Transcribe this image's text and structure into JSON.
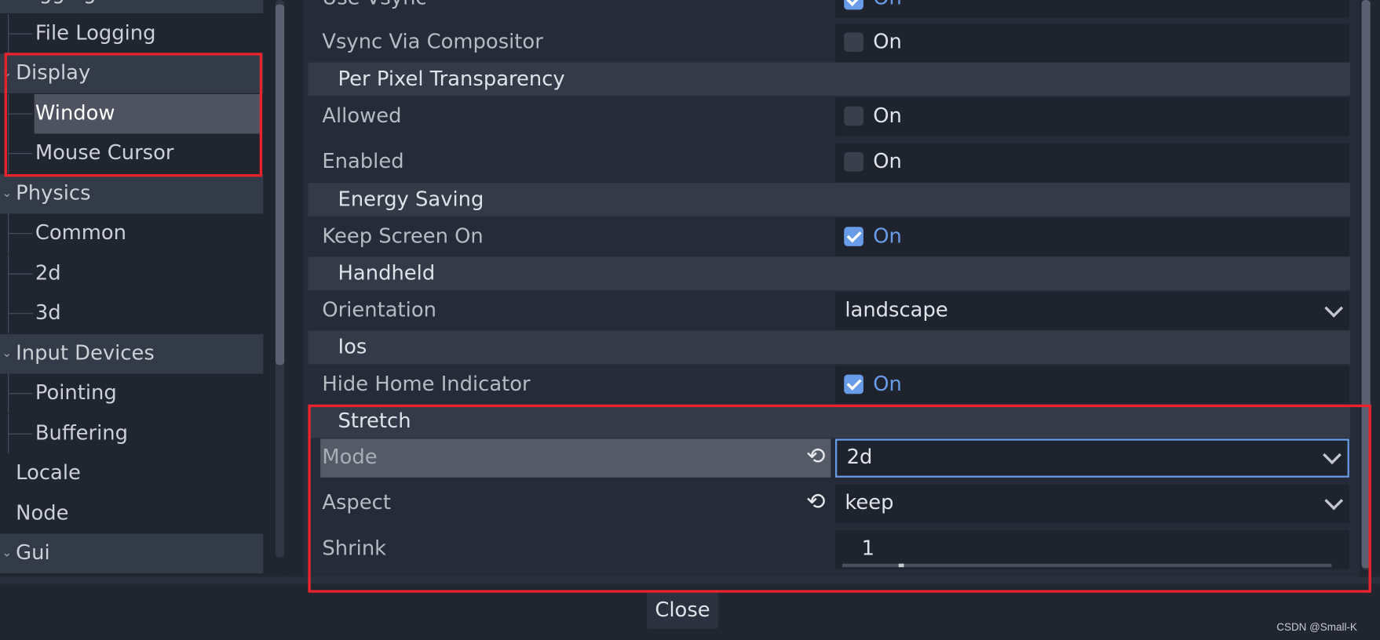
{
  "tree": {
    "items": [
      {
        "label": "Logging",
        "type": "category"
      },
      {
        "label": "File Logging",
        "type": "child"
      },
      {
        "label": "Display",
        "type": "category"
      },
      {
        "label": "Window",
        "type": "child",
        "selected": true
      },
      {
        "label": "Mouse Cursor",
        "type": "child"
      },
      {
        "label": "Physics",
        "type": "category"
      },
      {
        "label": "Common",
        "type": "child"
      },
      {
        "label": "2d",
        "type": "child"
      },
      {
        "label": "3d",
        "type": "child"
      },
      {
        "label": "Input Devices",
        "type": "category"
      },
      {
        "label": "Pointing",
        "type": "child"
      },
      {
        "label": "Buffering",
        "type": "child"
      },
      {
        "label": "Locale",
        "type": "plain"
      },
      {
        "label": "Node",
        "type": "plain"
      },
      {
        "label": "Gui",
        "type": "category"
      }
    ]
  },
  "inspector": {
    "use_vsync": {
      "label": "Use Vsync",
      "value": "On",
      "checked": true
    },
    "vsync_via_compositor": {
      "label": "Vsync Via Compositor",
      "value": "On",
      "checked": false
    },
    "section_ppt": "Per Pixel Transparency",
    "allowed": {
      "label": "Allowed",
      "value": "On",
      "checked": false
    },
    "enabled": {
      "label": "Enabled",
      "value": "On",
      "checked": false
    },
    "section_energy": "Energy Saving",
    "keep_screen_on": {
      "label": "Keep Screen On",
      "value": "On",
      "checked": true
    },
    "section_handheld": "Handheld",
    "orientation": {
      "label": "Orientation",
      "value": "landscape"
    },
    "section_ios": "Ios",
    "hide_home_indicator": {
      "label": "Hide Home Indicator",
      "value": "On",
      "checked": true
    },
    "section_stretch": "Stretch",
    "mode": {
      "label": "Mode",
      "value": "2d"
    },
    "aspect": {
      "label": "Aspect",
      "value": "keep"
    },
    "shrink": {
      "label": "Shrink",
      "value": "1"
    }
  },
  "footer": {
    "close_label": "Close"
  },
  "watermark": "CSDN @Small-K",
  "colors": {
    "accent": "#699ce8",
    "highlight": "#e8232b",
    "background": "#21252f"
  }
}
